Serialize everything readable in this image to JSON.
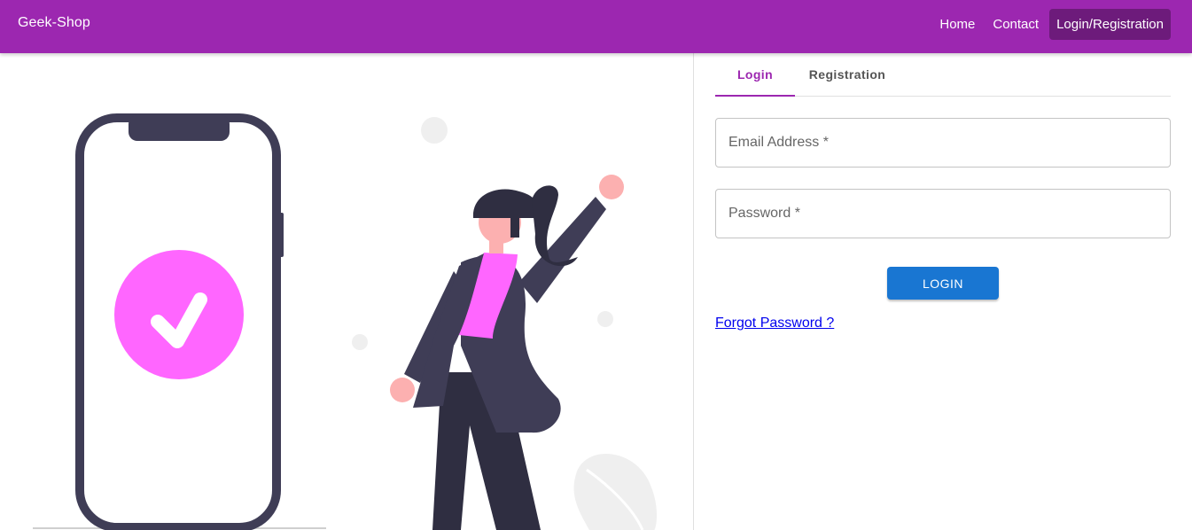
{
  "header": {
    "brand": "Geek-Shop",
    "nav": [
      "Home",
      "Contact",
      "Login/Registration"
    ],
    "active_nav": "Login/Registration"
  },
  "auth": {
    "tabs": [
      "Login",
      "Registration"
    ],
    "active_tab": "Login",
    "email": {
      "label": "Email Address *",
      "value": ""
    },
    "password": {
      "label": "Password *",
      "value": ""
    },
    "login_button": "LOGIN",
    "forgot_link": "Forgot Password ?"
  },
  "colors": {
    "primary": "#9c27b0",
    "primary_dark": "#6d1b7b",
    "button": "#1976d2",
    "check_circle": "#ff66ff",
    "illustration_dark": "#3f3d56",
    "skin": "#fcb0b0"
  },
  "illustration": {
    "subject": "phone with checkmark and woman raising fist",
    "icons": [
      "phone-icon",
      "check-icon"
    ]
  }
}
